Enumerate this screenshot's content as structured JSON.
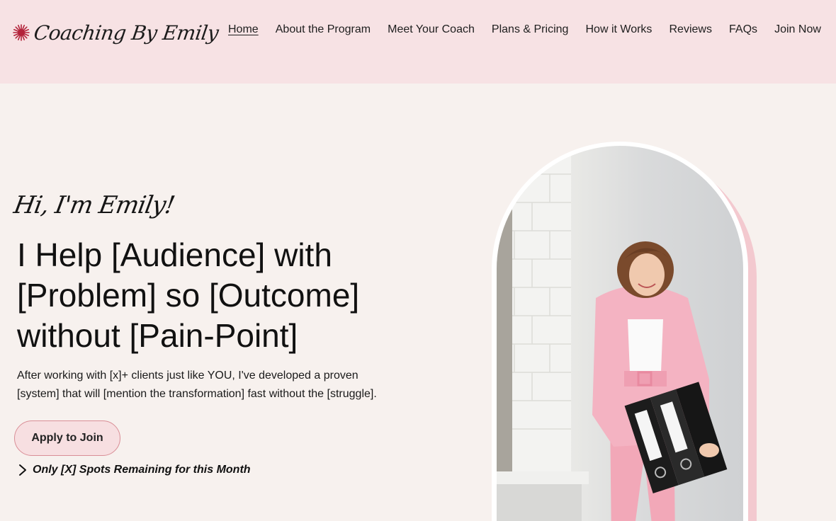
{
  "brand": {
    "name": "Coaching By Emily",
    "accent": "#b3233a"
  },
  "nav": {
    "items": [
      {
        "label": "Home",
        "active": true
      },
      {
        "label": "About the Program"
      },
      {
        "label": "Meet Your Coach"
      },
      {
        "label": "Plans & Pricing"
      },
      {
        "label": "How it Works"
      },
      {
        "label": "Reviews"
      },
      {
        "label": "FAQs"
      },
      {
        "label": "Join Now"
      }
    ]
  },
  "hero": {
    "greeting": "Hi, I'm Emily!",
    "headline": "I Help [Audience] with [Problem] so [Outcome] without [Pain-Point]",
    "subtext": "After working with [x]+ clients just like YOU, I've developed a proven [system] that will [mention the transformation] fast without the [struggle].",
    "cta_label": "Apply to Join",
    "spots_text": "Only [X] Spots Remaining for this Month"
  },
  "colors": {
    "header_bg": "#f7e2e4",
    "page_bg": "#f7f1ee",
    "button_bg": "#f7dfe1",
    "button_border": "#d98e96",
    "arch_shadow": "#f3c9cf",
    "suit_pink": "#f2a8b8"
  },
  "icons": {
    "logo": "sunburst-icon",
    "spots": "chevron-right-icon"
  }
}
